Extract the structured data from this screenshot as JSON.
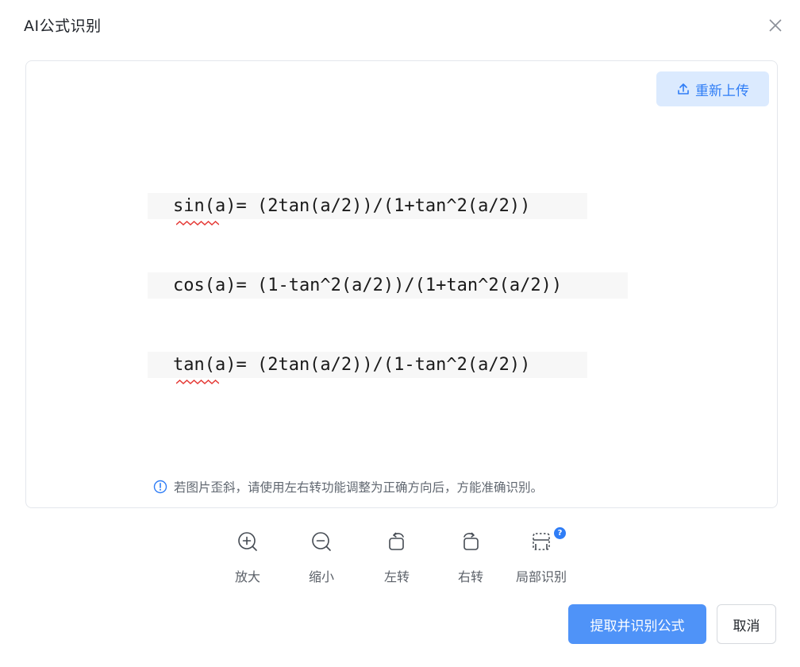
{
  "dialog": {
    "title": "AI公式识别",
    "close_icon": "close-icon"
  },
  "preview": {
    "reupload_label": "重新上传",
    "reupload_icon": "upload-icon",
    "formulas": [
      "sin(a)= (2tan(a/2))/(1+tan^2(a/2))",
      "cos(a)= (1-tan^2(a/2))/(1+tan^2(a/2))",
      "tan(a)= (2tan(a/2))/(1-tan^2(a/2))"
    ],
    "hint": "若图片歪斜，请使用左右转功能调整为正确方向后，方能准确识别。",
    "hint_icon": "info-icon"
  },
  "toolbar": {
    "items": [
      {
        "label": "放大",
        "icon": "zoom-in-icon"
      },
      {
        "label": "缩小",
        "icon": "zoom-out-icon"
      },
      {
        "label": "左转",
        "icon": "rotate-left-icon"
      },
      {
        "label": "右转",
        "icon": "rotate-right-icon"
      },
      {
        "label": "局部识别",
        "icon": "crop-select-icon",
        "badge": "?"
      }
    ]
  },
  "footer": {
    "primary_label": "提取并识别公式",
    "cancel_label": "取消"
  },
  "colors": {
    "accent": "#2f7df6",
    "primary_button": "#4f93f8",
    "reupload_bg": "#dbeafe",
    "spellcheck": "#e53935"
  }
}
